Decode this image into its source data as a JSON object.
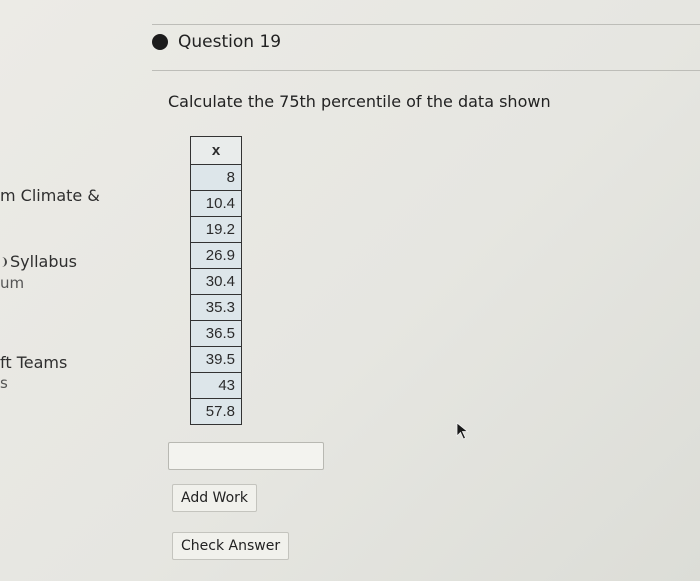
{
  "sidebar": {
    "items": [
      {
        "label": "m Climate &"
      },
      {
        "label": "Syllabus",
        "sub": "um"
      },
      {
        "label": "ft Teams",
        "sub": "s"
      }
    ]
  },
  "question": {
    "title": "Question 19",
    "prompt": "Calculate the 75th percentile of the data shown",
    "table": {
      "header": "x",
      "values": [
        "8",
        "10.4",
        "19.2",
        "26.9",
        "30.4",
        "35.3",
        "36.5",
        "39.5",
        "43",
        "57.8"
      ]
    },
    "answer": {
      "value": "",
      "placeholder": ""
    },
    "add_work_label": "Add Work",
    "check_answer_label": "Check Answer"
  }
}
